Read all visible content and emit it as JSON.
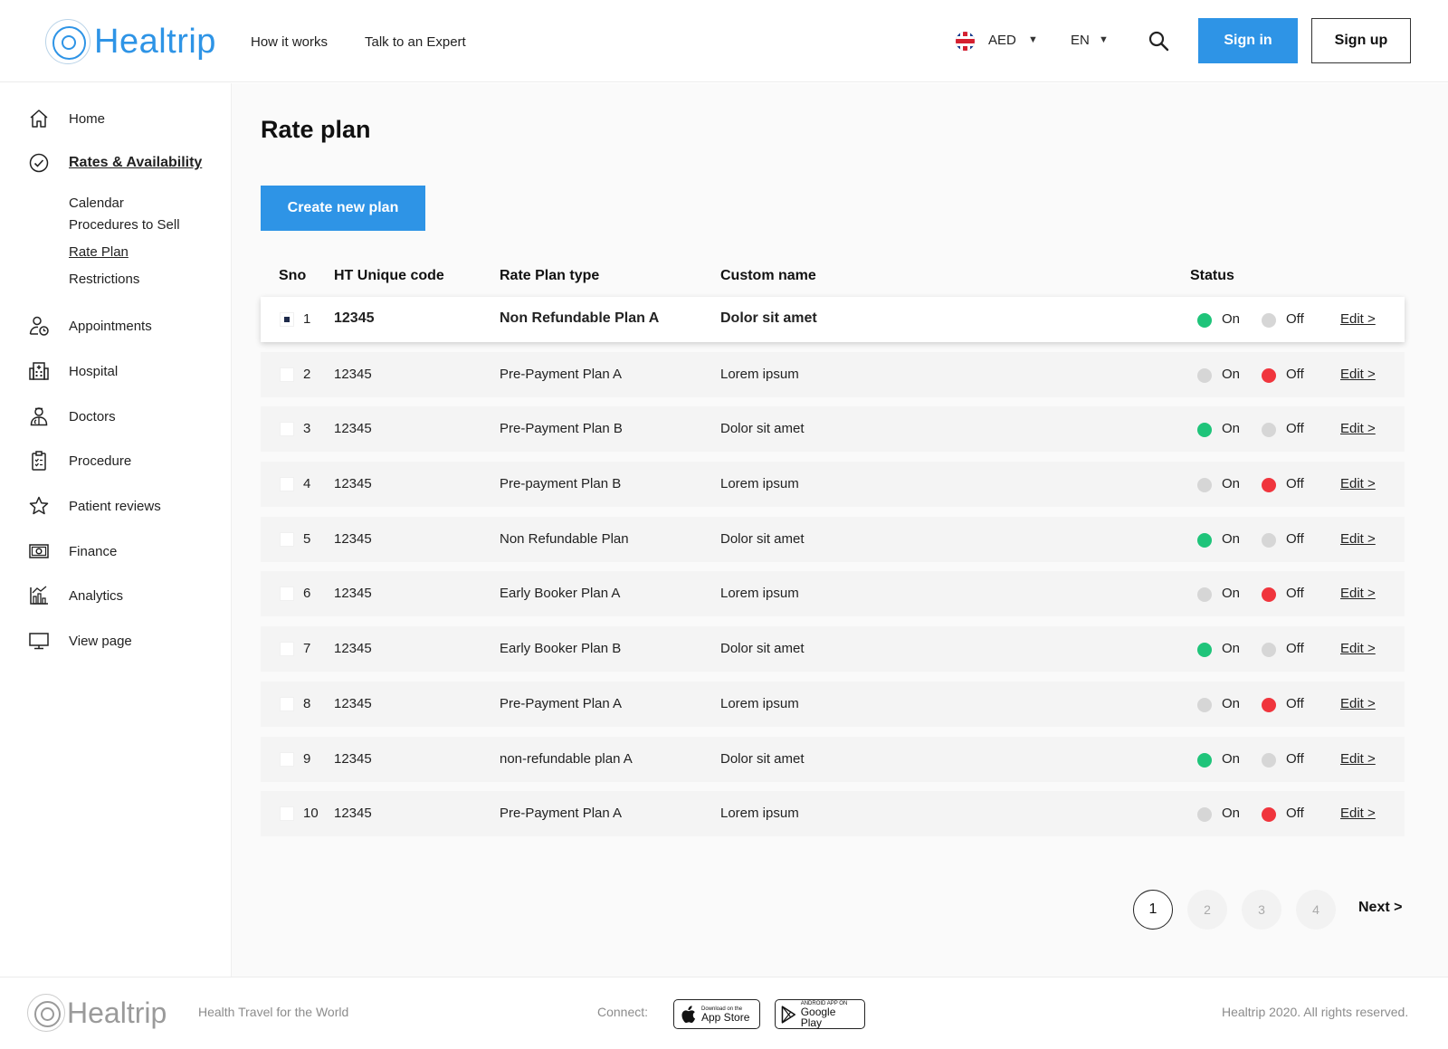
{
  "header": {
    "logo_text": "Healtrip",
    "nav": [
      "How it works",
      "Talk to an Expert"
    ],
    "currency": "AED",
    "language": "EN",
    "sign_in": "Sign in",
    "sign_up": "Sign up"
  },
  "sidebar": {
    "items": [
      {
        "label": "Home",
        "icon": "home-icon"
      },
      {
        "label": "Rates & Availability",
        "icon": "check-circle-icon",
        "active": true
      },
      {
        "label": "Appointments",
        "icon": "user-clock-icon"
      },
      {
        "label": "Hospital",
        "icon": "hospital-icon"
      },
      {
        "label": "Doctors",
        "icon": "doctor-icon"
      },
      {
        "label": "Procedure",
        "icon": "clipboard-icon"
      },
      {
        "label": "Patient reviews",
        "icon": "star-icon"
      },
      {
        "label": "Finance",
        "icon": "cash-icon"
      },
      {
        "label": "Analytics",
        "icon": "analytics-icon"
      },
      {
        "label": "View page",
        "icon": "monitor-icon"
      }
    ],
    "sub_items": [
      "Calendar",
      "Procedures to Sell",
      "Rate Plan",
      "Restrictions"
    ]
  },
  "main": {
    "title": "Rate plan",
    "create_button": "Create new plan",
    "columns": [
      "Sno",
      "HT Unique code",
      "Rate Plan type",
      "Custom name",
      "Status"
    ],
    "on_label": "On",
    "off_label": "Off",
    "edit_label": "Edit >",
    "rows": [
      {
        "sno": "1",
        "code": "12345",
        "type": "Non Refundable Plan A",
        "name": "Dolor sit amet",
        "status": "on",
        "selected": true
      },
      {
        "sno": "2",
        "code": "12345",
        "type": "Pre-Payment Plan A",
        "name": "Lorem ipsum",
        "status": "off"
      },
      {
        "sno": "3",
        "code": "12345",
        "type": "Pre-Payment Plan B",
        "name": "Dolor sit amet",
        "status": "on"
      },
      {
        "sno": "4",
        "code": "12345",
        "type": "Pre-payment Plan B",
        "name": "Lorem ipsum",
        "status": "off"
      },
      {
        "sno": "5",
        "code": "12345",
        "type": "Non Refundable Plan",
        "name": "Dolor sit amet",
        "status": "on"
      },
      {
        "sno": "6",
        "code": "12345",
        "type": "Early Booker Plan A",
        "name": "Lorem ipsum",
        "status": "off"
      },
      {
        "sno": "7",
        "code": "12345",
        "type": "Early Booker Plan B",
        "name": "Dolor sit amet",
        "status": "on"
      },
      {
        "sno": "8",
        "code": "12345",
        "type": "Pre-Payment Plan A",
        "name": "Lorem ipsum",
        "status": "off"
      },
      {
        "sno": "9",
        "code": "12345",
        "type": "non-refundable plan A",
        "name": "Dolor sit amet",
        "status": "on"
      },
      {
        "sno": "10",
        "code": "12345",
        "type": "Pre-Payment Plan A",
        "name": "Lorem ipsum",
        "status": "off"
      }
    ],
    "pagination": {
      "pages": [
        "1",
        "2",
        "3",
        "4"
      ],
      "current": "1",
      "next": "Next >"
    }
  },
  "footer": {
    "logo_text": "Healtrip",
    "tagline": "Health Travel for the World",
    "connect": "Connect:",
    "app_store_small": "Download on the",
    "app_store": "App Store",
    "google_play_small": "ANDROID APP ON",
    "google_play": "Google Play",
    "copyright": "Healtrip 2020. All rights reserved."
  },
  "colors": {
    "accent": "#2e94e6",
    "on": "#1fc47a",
    "off": "#f0353d",
    "inactive": "#d6d6d6"
  }
}
